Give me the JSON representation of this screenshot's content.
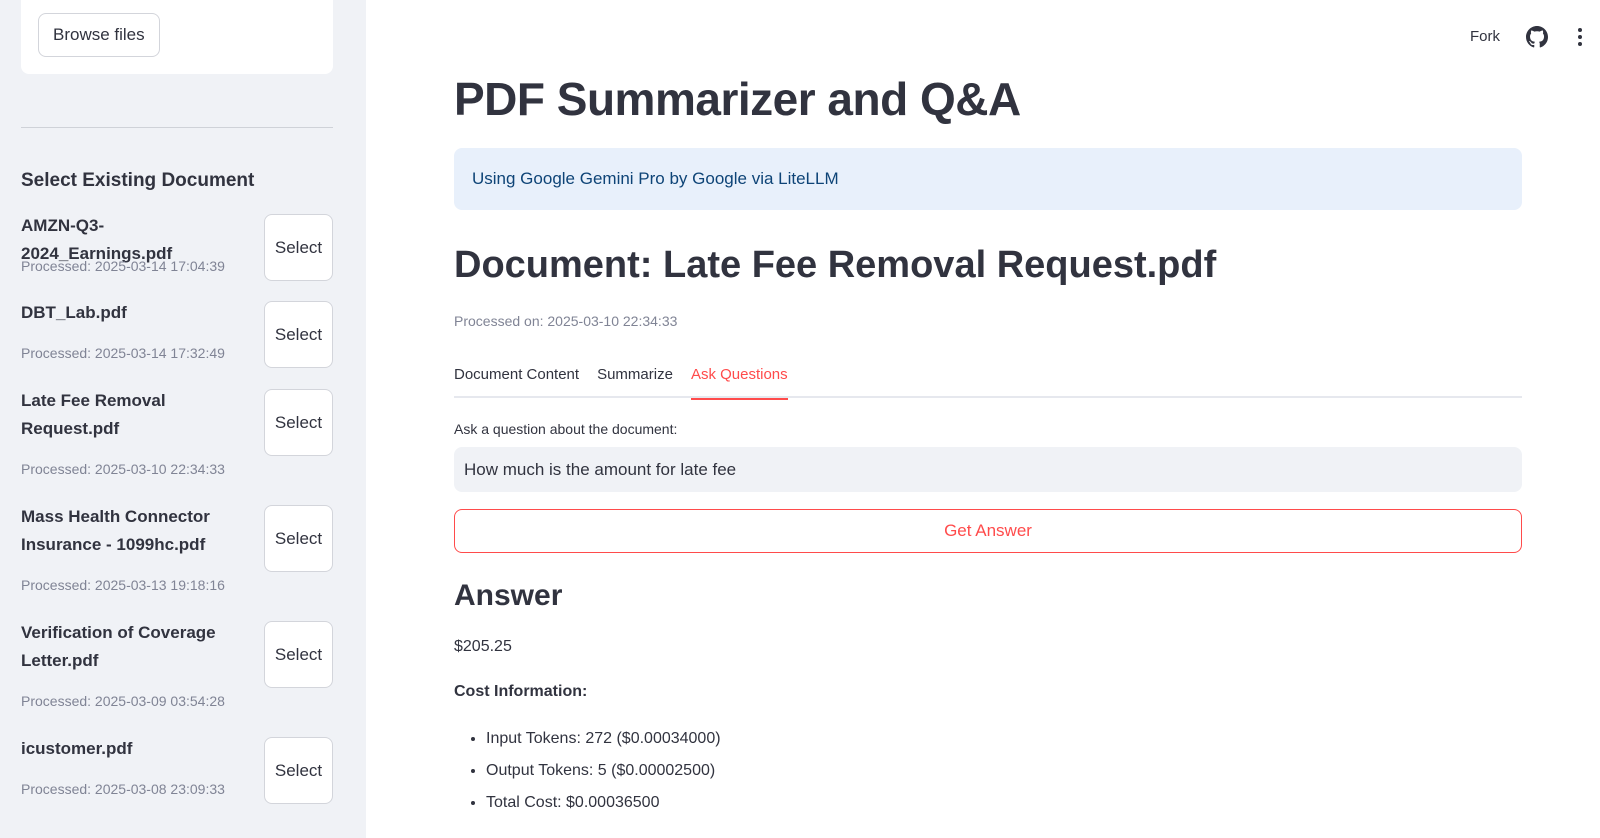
{
  "sidebar": {
    "browse_button": "Browse files",
    "heading": "Select Existing Document",
    "select_label": "Select",
    "documents": [
      {
        "name": "AMZN-Q3-2024_Earnings.pdf",
        "processed": "Processed: 2025-03-14 17:04:39"
      },
      {
        "name": "DBT_Lab.pdf",
        "processed": "Processed: 2025-03-14 17:32:49"
      },
      {
        "name": "Late Fee Removal Request.pdf",
        "processed": "Processed: 2025-03-10 22:34:33"
      },
      {
        "name": "Mass Health Connector Insurance - 1099hc.pdf",
        "processed": "Processed: 2025-03-13 19:18:16"
      },
      {
        "name": "Verification of Coverage Letter.pdf",
        "processed": "Processed: 2025-03-09 03:54:28"
      },
      {
        "name": "icustomer.pdf",
        "processed": "Processed: 2025-03-08 23:09:33"
      }
    ]
  },
  "topbar": {
    "fork_label": "Fork",
    "github_icon": "github-icon",
    "menu_icon": "more-vertical-icon"
  },
  "main": {
    "title": "PDF Summarizer and Q&A",
    "info": "Using Google Gemini Pro by Google via LiteLLM",
    "document_title": "Document: Late Fee Removal Request.pdf",
    "processed_on": "Processed on: 2025-03-10 22:34:33",
    "tabs": [
      {
        "label": "Document Content",
        "active": false
      },
      {
        "label": "Summarize",
        "active": false
      },
      {
        "label": "Ask Questions",
        "active": true
      }
    ],
    "question_label": "Ask a question about the document:",
    "question_value": "How much is the amount for late fee",
    "get_answer_button": "Get Answer",
    "answer_heading": "Answer",
    "answer": "$205.25",
    "cost_heading": "Cost Information:",
    "cost_items": [
      "Input Tokens: 272 ($0.00034000)",
      "Output Tokens: 5 ($0.00002500)",
      "Total Cost: $0.00036500"
    ]
  },
  "colors": {
    "accent": "#ff4b4b",
    "sidebar_bg": "#f0f2f6",
    "info_bg": "#e8f0fb",
    "info_text": "#0e4477",
    "muted_text": "#808495"
  }
}
